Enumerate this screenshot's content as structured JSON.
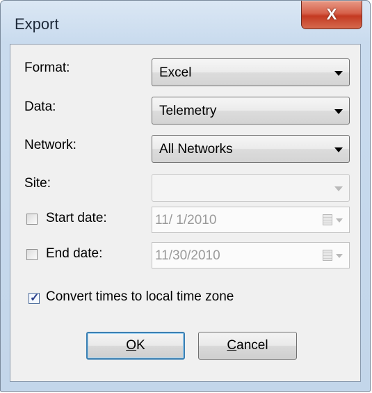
{
  "window": {
    "title": "Export",
    "close_glyph": "X"
  },
  "fields": {
    "format": {
      "label": "Format:",
      "value": "Excel"
    },
    "data": {
      "label": "Data:",
      "value": "Telemetry"
    },
    "network": {
      "label": "Network:",
      "value": "All Networks"
    },
    "site": {
      "label": "Site:",
      "value": ""
    },
    "start_date": {
      "label": "Start date:",
      "value": "11/  1/2010",
      "checked": false
    },
    "end_date": {
      "label": "End date:",
      "value": "11/30/2010",
      "checked": false
    },
    "convert_times": {
      "label": "Convert times to local time zone",
      "checked": true
    }
  },
  "buttons": {
    "ok": {
      "mnemonic": "O",
      "rest": "K"
    },
    "cancel": {
      "mnemonic": "C",
      "rest": "ancel"
    }
  }
}
